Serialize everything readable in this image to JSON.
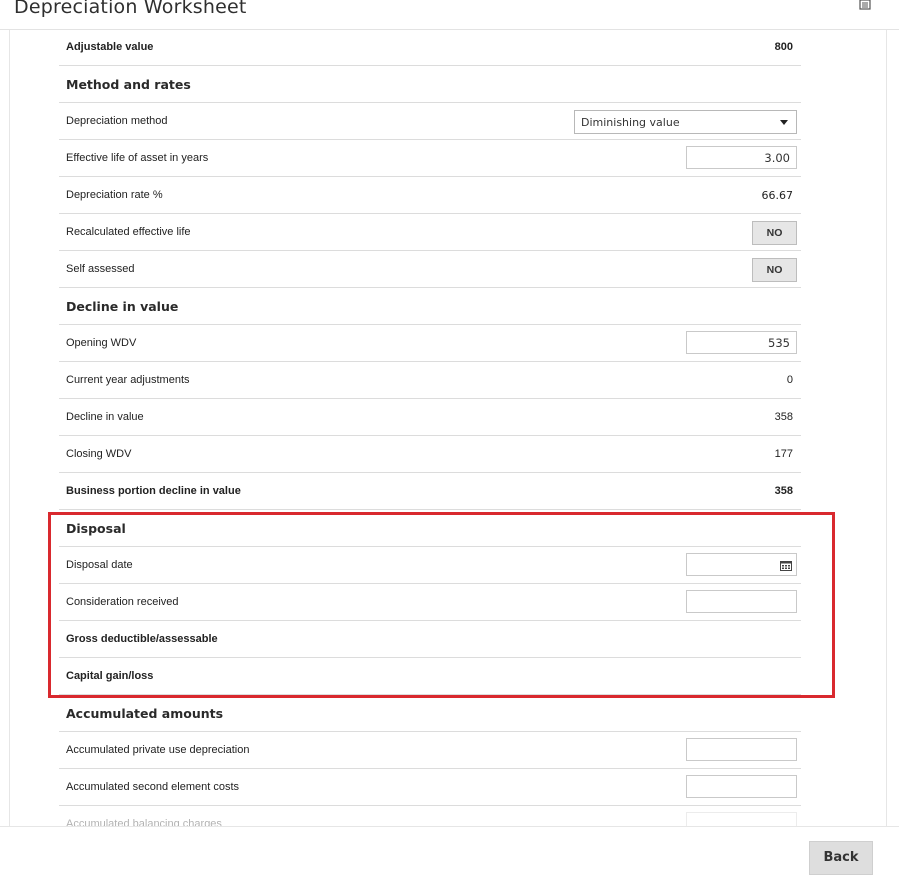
{
  "header": {
    "title": "Depreciation Worksheet",
    "trash_icon": "trash-icon"
  },
  "rows": {
    "adjustable_value": {
      "label": "Adjustable value",
      "value": "800"
    },
    "method_section": "Method and rates",
    "depreciation_method": {
      "label": "Depreciation method",
      "value": "Diminishing value"
    },
    "effective_life": {
      "label": "Effective life of asset in years",
      "value": "3.00"
    },
    "depreciation_rate": {
      "label": "Depreciation rate %",
      "value": "66.67"
    },
    "recalculated_life": {
      "label": "Recalculated effective life",
      "value": "NO"
    },
    "self_assessed": {
      "label": "Self assessed",
      "value": "NO"
    },
    "decline_section": "Decline in value",
    "opening_wdv": {
      "label": "Opening WDV",
      "value": "535"
    },
    "current_year_adjustments": {
      "label": "Current year adjustments",
      "value": "0"
    },
    "decline_in_value": {
      "label": "Decline in value",
      "value": "358"
    },
    "closing_wdv": {
      "label": "Closing WDV",
      "value": "177"
    },
    "business_portion": {
      "label": "Business portion decline in value",
      "value": "358"
    },
    "disposal_section": "Disposal",
    "disposal_date": {
      "label": "Disposal date",
      "value": ""
    },
    "consideration_received": {
      "label": "Consideration received",
      "value": ""
    },
    "gross_deductible": {
      "label": "Gross deductible/assessable"
    },
    "capital_gain": {
      "label": "Capital gain/loss"
    },
    "accumulated_section": "Accumulated amounts",
    "accumulated_private": {
      "label": "Accumulated private use depreciation",
      "value": ""
    },
    "accumulated_second": {
      "label": "Accumulated second element costs",
      "value": ""
    },
    "accumulated_balancing": {
      "label": "Accumulated balancing charges",
      "value": ""
    }
  },
  "footer": {
    "back_label": "Back"
  },
  "colors": {
    "highlight": "#d9292e",
    "button": "#dedede"
  }
}
